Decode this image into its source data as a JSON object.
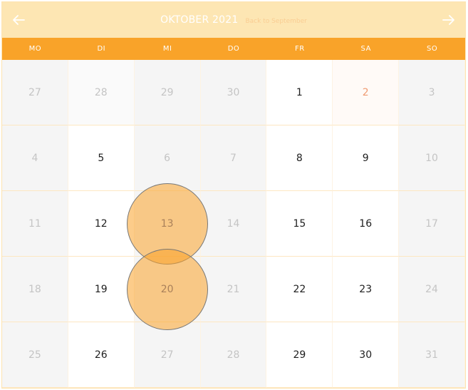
{
  "header": {
    "month_title": "OKTOBER 2021",
    "back_link": "Back to September",
    "prev_icon": "arrow-left-icon",
    "next_icon": "arrow-right-icon"
  },
  "weekdays": [
    "MO",
    "DI",
    "MI",
    "DO",
    "FR",
    "SA",
    "SO"
  ],
  "weeks": [
    [
      {
        "day": "27",
        "state": "muted"
      },
      {
        "day": "28",
        "state": "faint"
      },
      {
        "day": "29",
        "state": "muted"
      },
      {
        "day": "30",
        "state": "muted"
      },
      {
        "day": "1",
        "state": "avail"
      },
      {
        "day": "2",
        "state": "hol"
      },
      {
        "day": "3",
        "state": "muted"
      }
    ],
    [
      {
        "day": "4",
        "state": "muted"
      },
      {
        "day": "5",
        "state": "avail"
      },
      {
        "day": "6",
        "state": "muted"
      },
      {
        "day": "7",
        "state": "muted"
      },
      {
        "day": "8",
        "state": "avail"
      },
      {
        "day": "9",
        "state": "avail"
      },
      {
        "day": "10",
        "state": "muted"
      }
    ],
    [
      {
        "day": "11",
        "state": "muted"
      },
      {
        "day": "12",
        "state": "avail"
      },
      {
        "day": "13",
        "state": "sel"
      },
      {
        "day": "14",
        "state": "muted"
      },
      {
        "day": "15",
        "state": "avail"
      },
      {
        "day": "16",
        "state": "avail"
      },
      {
        "day": "17",
        "state": "muted"
      }
    ],
    [
      {
        "day": "18",
        "state": "muted"
      },
      {
        "day": "19",
        "state": "avail"
      },
      {
        "day": "20",
        "state": "sel"
      },
      {
        "day": "21",
        "state": "muted"
      },
      {
        "day": "22",
        "state": "avail"
      },
      {
        "day": "23",
        "state": "avail"
      },
      {
        "day": "24",
        "state": "muted"
      }
    ],
    [
      {
        "day": "25",
        "state": "muted"
      },
      {
        "day": "26",
        "state": "avail"
      },
      {
        "day": "27",
        "state": "muted"
      },
      {
        "day": "28",
        "state": "muted"
      },
      {
        "day": "29",
        "state": "avail"
      },
      {
        "day": "30",
        "state": "avail"
      },
      {
        "day": "31",
        "state": "muted"
      }
    ]
  ],
  "colors": {
    "header_bg": "#fde6b3",
    "weekday_bg": "#f9a329",
    "selection": "#f9a329",
    "holiday_text": "#ef9b72"
  }
}
